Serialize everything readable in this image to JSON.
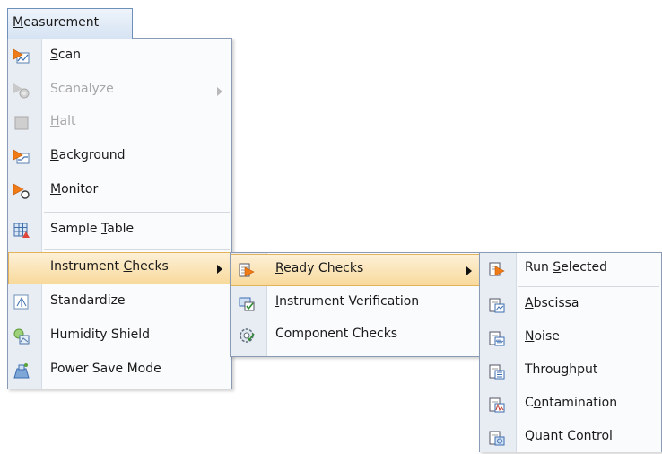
{
  "menubar": {
    "tab_pre": "",
    "tab_ul": "M",
    "tab_post": "easurement"
  },
  "measurement_menu": {
    "items": [
      {
        "pre": "",
        "ul": "S",
        "post": "can"
      },
      {
        "pre": "",
        "ul": "",
        "post": "Scanalyze"
      },
      {
        "pre": "",
        "ul": "H",
        "post": "alt"
      },
      {
        "pre": "",
        "ul": "B",
        "post": "ackground"
      },
      {
        "pre": "",
        "ul": "M",
        "post": "onitor"
      },
      {
        "pre": "Sample ",
        "ul": "T",
        "post": "able"
      },
      {
        "pre": "Instrument ",
        "ul": "C",
        "post": "hecks"
      },
      {
        "pre": "",
        "ul": "",
        "post": "Standardize"
      },
      {
        "pre": "",
        "ul": "",
        "post": "Humidity Shield"
      },
      {
        "pre": "",
        "ul": "",
        "post": "Power Save Mode"
      }
    ]
  },
  "instrument_checks_menu": {
    "items": [
      {
        "pre": "",
        "ul": "R",
        "post": "eady Checks"
      },
      {
        "pre": "",
        "ul": "I",
        "post": "nstrument Verification"
      },
      {
        "pre": "",
        "ul": "",
        "post": "Component Checks"
      }
    ]
  },
  "ready_checks_menu": {
    "items": [
      {
        "pre": "Run ",
        "ul": "S",
        "post": "elected"
      },
      {
        "pre": "",
        "ul": "A",
        "post": "bscissa"
      },
      {
        "pre": "",
        "ul": "N",
        "post": "oise"
      },
      {
        "pre": "Throu",
        "ul": "g",
        "post": "hput"
      },
      {
        "pre": "C",
        "ul": "o",
        "post": "ntamination"
      },
      {
        "pre": "",
        "ul": "Q",
        "post": "uant Control"
      }
    ]
  },
  "colors": {
    "highlight": "#f8d99a",
    "menu_border": "#8a9cb5",
    "disabled_text": "#a7a7a7"
  }
}
